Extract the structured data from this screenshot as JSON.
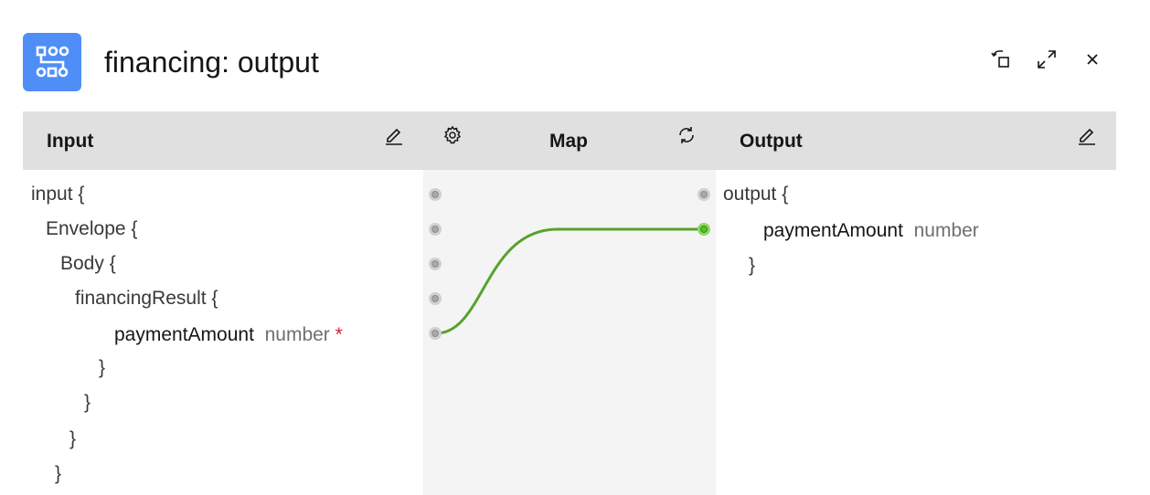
{
  "header": {
    "title": "financing: output",
    "app_icon": "map-node-icon",
    "buttons": [
      "restore-icon",
      "maximize-icon",
      "close-icon"
    ]
  },
  "input_panel": {
    "title": "Input",
    "edit_icon": "pencil-icon",
    "tree": {
      "root": "input {",
      "envelope": "Envelope {",
      "body": "Body {",
      "financing_result": "financingResult {",
      "field_name": "paymentAmount",
      "field_type": "number",
      "required_mark": "*",
      "close_brace": "}"
    }
  },
  "map_panel": {
    "title": "Map",
    "settings_icon": "gear-icon",
    "refresh_icon": "refresh-icon"
  },
  "output_panel": {
    "title": "Output",
    "edit_icon": "pencil-icon",
    "tree": {
      "root": "output {",
      "field_name": "paymentAmount",
      "field_type": "number",
      "close_brace": "}"
    }
  },
  "colors": {
    "accent": "#4f8ef7",
    "header_bg": "#e0e0e0",
    "map_bg": "#f4f4f4",
    "wire": "#56a32b",
    "required": "#da1e28"
  }
}
